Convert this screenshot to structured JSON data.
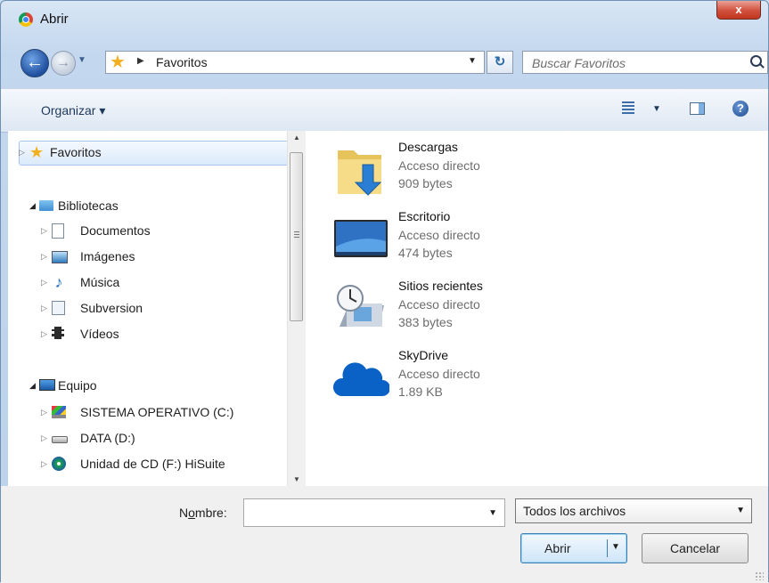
{
  "window": {
    "title": "Abrir",
    "close_label": "x"
  },
  "address": {
    "location": "Favoritos",
    "search_placeholder": "Buscar Favoritos"
  },
  "toolbar": {
    "organize_label": "Organizar ▾"
  },
  "nav": {
    "favorites": "Favoritos",
    "libraries": "Bibliotecas",
    "library_items": [
      "Documentos",
      "Imágenes",
      "Música",
      "Subversion",
      "Vídeos"
    ],
    "computer": "Equipo",
    "computer_items": [
      "SISTEMA OPERATIVO (C:)",
      "DATA (D:)",
      "Unidad de CD (F:) HiSuite"
    ]
  },
  "files": [
    {
      "name": "Descargas",
      "type": "Acceso directo",
      "size": "909 bytes",
      "icon": "downloads-folder-icon"
    },
    {
      "name": "Escritorio",
      "type": "Acceso directo",
      "size": "474 bytes",
      "icon": "desktop-icon"
    },
    {
      "name": "Sitios recientes",
      "type": "Acceso directo",
      "size": "383 bytes",
      "icon": "recent-places-icon"
    },
    {
      "name": "SkyDrive",
      "type": "Acceso directo",
      "size": "1.89 KB",
      "icon": "skydrive-cloud-icon"
    }
  ],
  "bottom": {
    "name_label_pre": "N",
    "name_label_u": "o",
    "name_label_post": "mbre:",
    "name_value": "",
    "file_type": "Todos los archivos",
    "open_label": "Abrir",
    "cancel_label": "Cancelar"
  },
  "colors": {
    "accent": "#3c7fb1",
    "selection": "#dbeafb",
    "close": "#c2361f"
  }
}
